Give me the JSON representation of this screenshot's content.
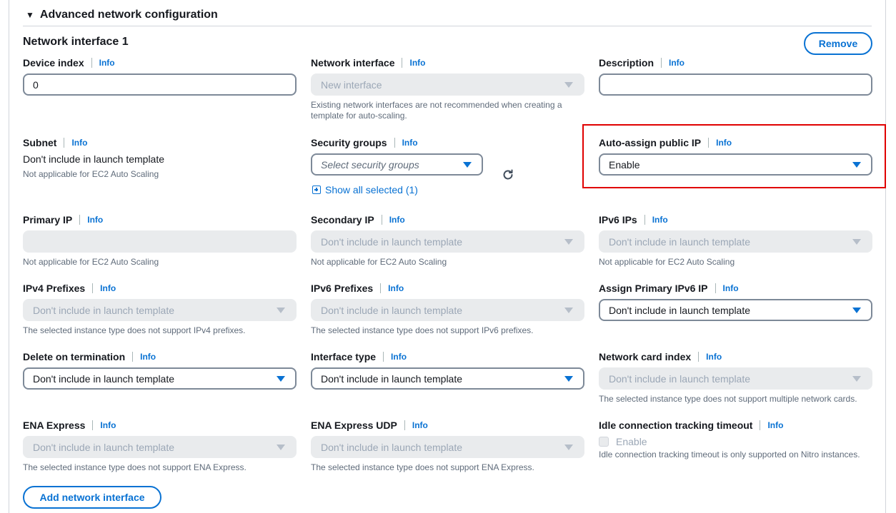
{
  "section": {
    "title": "Advanced network configuration"
  },
  "interface": {
    "title": "Network interface 1",
    "remove_label": "Remove"
  },
  "info_label": "Info",
  "fields": {
    "device_index": {
      "label": "Device index",
      "value": "0"
    },
    "network_interface": {
      "label": "Network interface",
      "value": "New interface",
      "help": "Existing network interfaces are not recommended when creating a template for auto-scaling."
    },
    "description": {
      "label": "Description",
      "value": ""
    },
    "subnet": {
      "label": "Subnet",
      "value": "Don't include in launch template",
      "help": "Not applicable for EC2 Auto Scaling"
    },
    "security_groups": {
      "label": "Security groups",
      "placeholder": "Select security groups",
      "show_all": "Show all selected (1)"
    },
    "auto_assign_ip": {
      "label": "Auto-assign public IP",
      "value": "Enable"
    },
    "primary_ip": {
      "label": "Primary IP",
      "value": "",
      "help": "Not applicable for EC2 Auto Scaling"
    },
    "secondary_ip": {
      "label": "Secondary IP",
      "value": "Don't include in launch template",
      "help": "Not applicable for EC2 Auto Scaling"
    },
    "ipv6_ips": {
      "label": "IPv6 IPs",
      "value": "Don't include in launch template",
      "help": "Not applicable for EC2 Auto Scaling"
    },
    "ipv4_prefixes": {
      "label": "IPv4 Prefixes",
      "value": "Don't include in launch template",
      "help": "The selected instance type does not support IPv4 prefixes."
    },
    "ipv6_prefixes": {
      "label": "IPv6 Prefixes",
      "value": "Don't include in launch template",
      "help": "The selected instance type does not support IPv6 prefixes."
    },
    "assign_primary_ipv6": {
      "label": "Assign Primary IPv6 IP",
      "value": "Don't include in launch template"
    },
    "delete_on_termination": {
      "label": "Delete on termination",
      "value": "Don't include in launch template"
    },
    "interface_type": {
      "label": "Interface type",
      "value": "Don't include in launch template"
    },
    "network_card_index": {
      "label": "Network card index",
      "value": "Don't include in launch template",
      "help": "The selected instance type does not support multiple network cards."
    },
    "ena_express": {
      "label": "ENA Express",
      "value": "Don't include in launch template",
      "help": "The selected instance type does not support ENA Express."
    },
    "ena_express_udp": {
      "label": "ENA Express UDP",
      "value": "Don't include in launch template",
      "help": "The selected instance type does not support ENA Express."
    },
    "idle_timeout": {
      "label": "Idle connection tracking timeout",
      "checkbox_label": "Enable",
      "help": "Idle connection tracking timeout is only supported on Nitro instances."
    }
  },
  "add_interface_label": "Add network interface",
  "colors": {
    "accent": "#0972d3",
    "highlight": "#e00000",
    "disabled_bg": "#e9ebed"
  }
}
